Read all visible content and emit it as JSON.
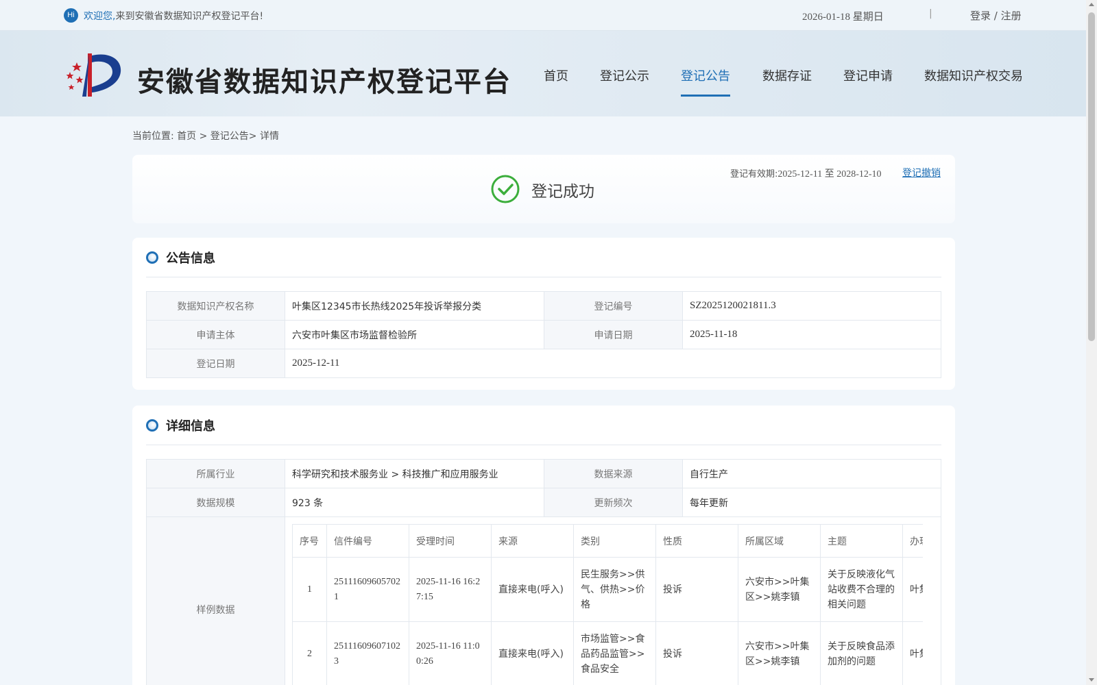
{
  "topbar": {
    "hi": "Hi",
    "welcome_accent": "欢迎您,",
    "welcome_rest": "来到安徽省数据知识产权登记平台!",
    "date": "2026-01-18 星期日",
    "separator": "|",
    "auth": "登录 / 注册"
  },
  "header": {
    "title": "安徽省数据知识产权登记平台",
    "nav": [
      "首页",
      "登记公示",
      "登记公告",
      "数据存证",
      "登记申请",
      "数据知识产权交易"
    ],
    "active_nav": "登记公告"
  },
  "breadcrumb": "当前位置: 首页 > 登记公告> 详情",
  "status": {
    "text": "登记成功",
    "validity_label": "登记有效期:",
    "validity_value": "2025-12-11 至 2028-12-10",
    "revoke": "登记撤销"
  },
  "announcement": {
    "title": "公告信息",
    "name_label": "数据知识产权名称",
    "name_value": "叶集区12345市长热线2025年投诉举报分类",
    "reg_no_label": "登记编号",
    "reg_no_value": "SZ2025120021811.3",
    "applicant_label": "申请主体",
    "applicant_value": "六安市叶集区市场监督检验所",
    "apply_date_label": "申请日期",
    "apply_date_value": "2025-11-18",
    "reg_date_label": "登记日期",
    "reg_date_value": "2025-12-11"
  },
  "detail": {
    "title": "详细信息",
    "industry_label": "所属行业",
    "industry_value": "科学研究和技术服务业 > 科技推广和应用服务业",
    "source_label": "数据来源",
    "source_value": "自行生产",
    "scale_label": "数据规模",
    "scale_value": "923 条",
    "freq_label": "更新频次",
    "freq_value": "每年更新",
    "sample_label": "样例数据",
    "sample_headers": [
      "序号",
      "信件编号",
      "受理时间",
      "来源",
      "类别",
      "性质",
      "所属区域",
      "主题",
      "办理"
    ],
    "sample_rows": [
      [
        "1",
        "251116096057021",
        "2025-11-16 16:27:15",
        "直接来电(呼入)",
        "民生服务>>供气、供热>>价格",
        "投诉",
        "六安市>>叶集区>>姚李镇",
        "关于反映液化气站收费不合理的相关问题",
        "叶集局"
      ],
      [
        "2",
        "251116096071023",
        "2025-11-16 11:00:26",
        "直接来电(呼入)",
        "市场监管>>食品药品监管>>食品安全",
        "投诉",
        "六安市>>叶集区>>姚李镇",
        "关于反映食品添加剂的问题",
        "叶集局"
      ]
    ]
  },
  "colors": {
    "accent": "#1f6fb5",
    "success": "#3cae3c",
    "page_bg": "#f1f6fb"
  }
}
